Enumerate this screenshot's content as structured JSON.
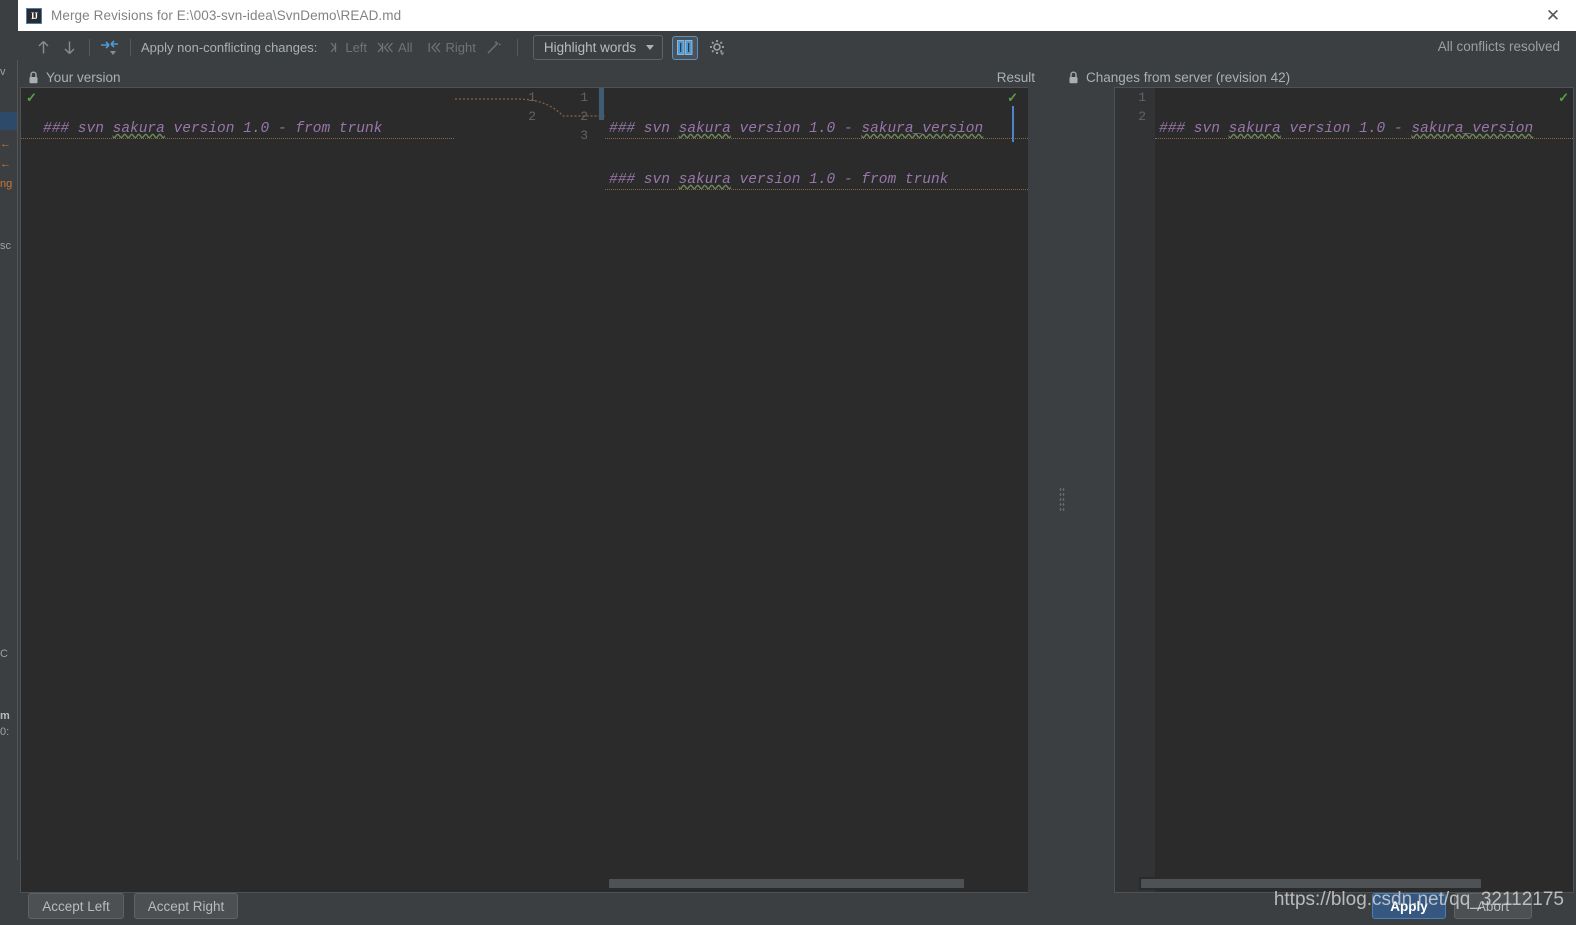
{
  "window": {
    "title": "Merge Revisions for E:\\003-svn-idea\\SvnDemo\\READ.md",
    "icon": "intellij-idea-icon",
    "close_label": "✕"
  },
  "toolbar": {
    "prev_icon": "arrow-up-icon",
    "next_icon": "arrow-down-icon",
    "apply_all_icon": "apply-non-conflicting-icon",
    "apply_label": "Apply non-conflicting changes:",
    "left_label": "Left",
    "all_label": "All",
    "right_label": "Right",
    "ignore_icon": "ignore-whitespace-icon",
    "highlight_mode": "Highlight words",
    "highlight_caret": "chevron-down-icon",
    "split_toggle_icon": "side-by-side-viewer-icon",
    "settings_icon": "gear-icon",
    "status": "All conflicts resolved"
  },
  "panes": {
    "left": {
      "title": "Your version",
      "lock_icon": "lock-icon",
      "lines": [
        {
          "no": "",
          "text": "### svn sakura version 1.0 - from trunk",
          "accepted": true
        }
      ]
    },
    "result": {
      "title": "Result",
      "gutter_left": [
        "1",
        "2"
      ],
      "gutter_right": [
        "1",
        "2",
        "3"
      ],
      "lines": [
        {
          "text": "### svn sakura version 1.0 - sakura_version",
          "accepted": true
        },
        {
          "text": "### svn sakura version 1.0 - from trunk",
          "accepted": false
        }
      ]
    },
    "right": {
      "title": "Changes from server (revision 42)",
      "lock_icon": "lock-icon",
      "gutter": [
        "1",
        "2"
      ],
      "lines": [
        {
          "text": "### svn sakura version 1.0 - sakura_version",
          "accepted": true
        }
      ]
    }
  },
  "buttons": {
    "accept_left": "Accept Left",
    "accept_right": "Accept Right",
    "apply": "Apply",
    "abort": "Abort"
  },
  "watermark": "https://blog.csdn.net/qq_32112175",
  "background_window": {
    "strips": [
      "v",
      "",
      "←",
      "←",
      "ng",
      "sc",
      "",
      "C",
      "m",
      "0:"
    ]
  },
  "colors": {
    "accent": "#4a7ebb",
    "dialog_bg": "#3c3f41",
    "editor_bg": "#2b2b2b",
    "gutter_bg": "#313335",
    "code_text": "#9876aa",
    "accept_green": "#5a9e4b",
    "titlebar_bg": "#ffffff",
    "apply_button": "#365880"
  }
}
